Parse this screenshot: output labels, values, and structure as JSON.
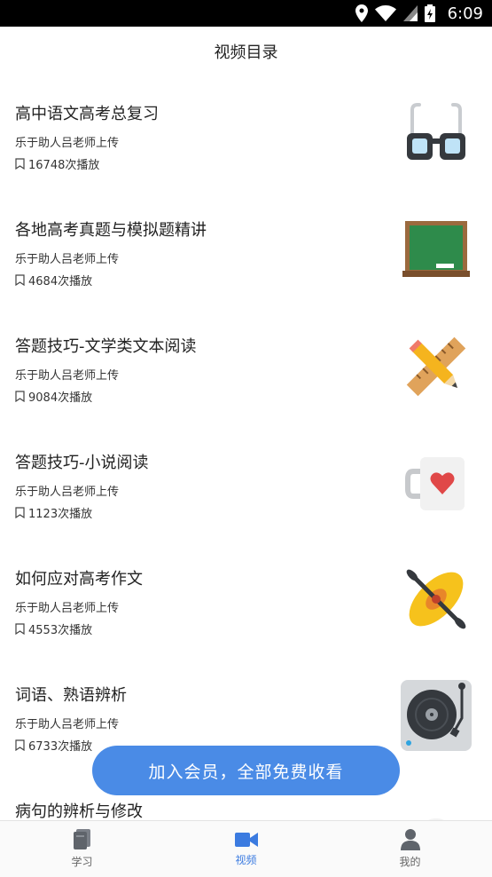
{
  "status_bar": {
    "time": "6:09"
  },
  "header": {
    "title": "视频目录"
  },
  "videos": [
    {
      "title": "高中语文高考总复习",
      "uploader": "乐于助人吕老师上传",
      "plays": "16748次播放",
      "icon": "glasses-icon"
    },
    {
      "title": "各地高考真题与模拟题精讲",
      "uploader": "乐于助人吕老师上传",
      "plays": "4684次播放",
      "icon": "chalkboard-icon"
    },
    {
      "title": "答题技巧-文学类文本阅读",
      "uploader": "乐于助人吕老师上传",
      "plays": "9084次播放",
      "icon": "ruler-pencil-icon"
    },
    {
      "title": "答题技巧-小说阅读",
      "uploader": "乐于助人吕老师上传",
      "plays": "1123次播放",
      "icon": "heart-mug-icon"
    },
    {
      "title": "如何应对高考作文",
      "uploader": "乐于助人吕老师上传",
      "plays": "4553次播放",
      "icon": "kayak-icon"
    },
    {
      "title": "词语、熟语辨析",
      "uploader": "乐于助人吕老师上传",
      "plays": "6733次播放",
      "icon": "turntable-icon"
    },
    {
      "title": "病句的辨析与修改",
      "uploader": "",
      "plays": "",
      "icon": "partial-icon"
    }
  ],
  "join_button": {
    "label": "加入会员，全部免费收看"
  },
  "tabs": [
    {
      "label": "学习",
      "icon": "book-icon"
    },
    {
      "label": "视频",
      "icon": "video-camera-icon",
      "active": true
    },
    {
      "label": "我的",
      "icon": "person-icon"
    }
  ],
  "colors": {
    "accent": "#4a8be6",
    "active_tab": "#3b7be0"
  }
}
